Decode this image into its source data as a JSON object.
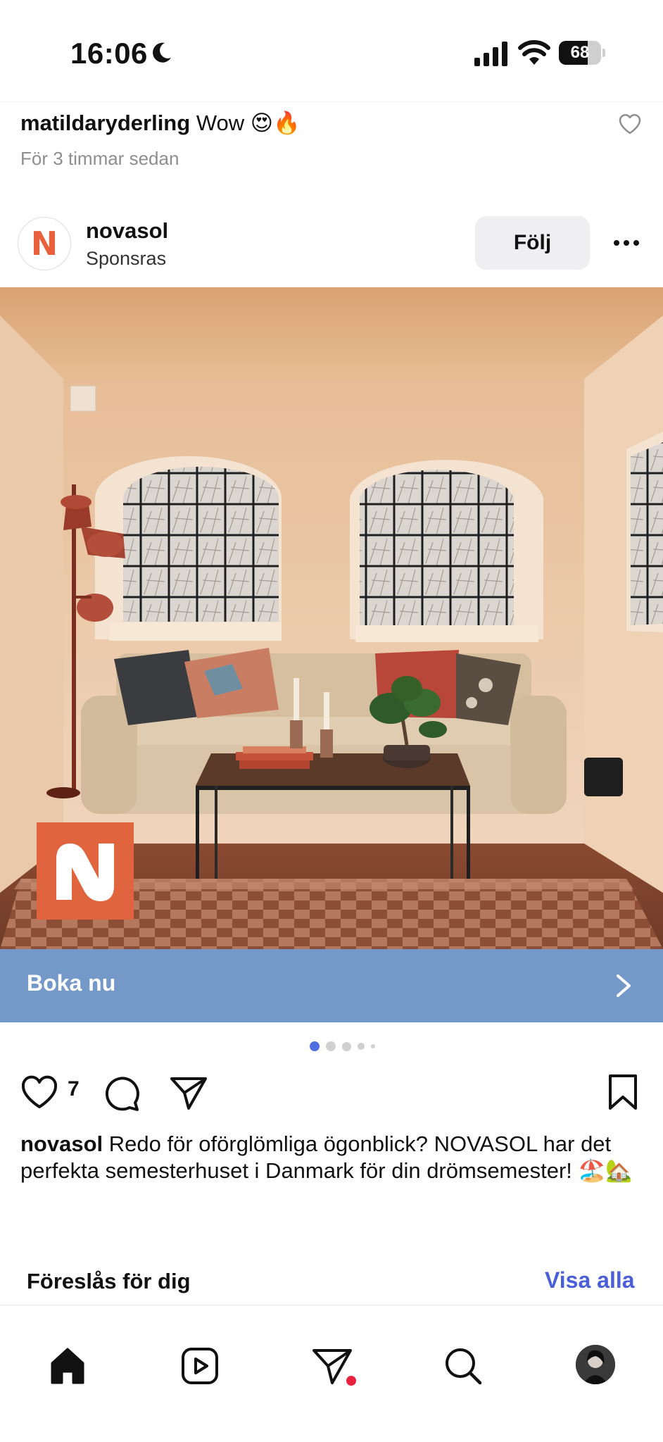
{
  "status_bar": {
    "time": "16:06",
    "battery_percent": 68,
    "battery_label": "68",
    "icons": [
      "moon-icon",
      "signal-icon",
      "wifi-icon",
      "battery-icon"
    ]
  },
  "comment": {
    "username": "matildaryderling",
    "text": "Wow 😍🔥",
    "time": "För 3 timmar sedan"
  },
  "post": {
    "account": "novasol",
    "sponsored_label": "Sponsras",
    "avatar_letter": "N",
    "follow_label": "Följ",
    "brand_color": "#e8613c",
    "cta_label": "Boka nu",
    "cta_color": "#7499c9",
    "carousel": {
      "total": 5,
      "active_index": 0
    },
    "likes": "7",
    "caption_username": "novasol",
    "caption_text": "Redo för oförglömliga ögonblick? NOVASOL har det perfekta semesterhuset i Danmark för din drömsemester! 🏖️🏡"
  },
  "suggestions": {
    "title": "Föreslås för dig",
    "see_all": "Visa alla",
    "link_color": "#4a5fd8"
  },
  "bottom_nav": {
    "items": [
      "home-icon",
      "reels-icon",
      "direct-icon",
      "search-icon",
      "profile-avatar"
    ],
    "notification_color": "#e8223c"
  }
}
